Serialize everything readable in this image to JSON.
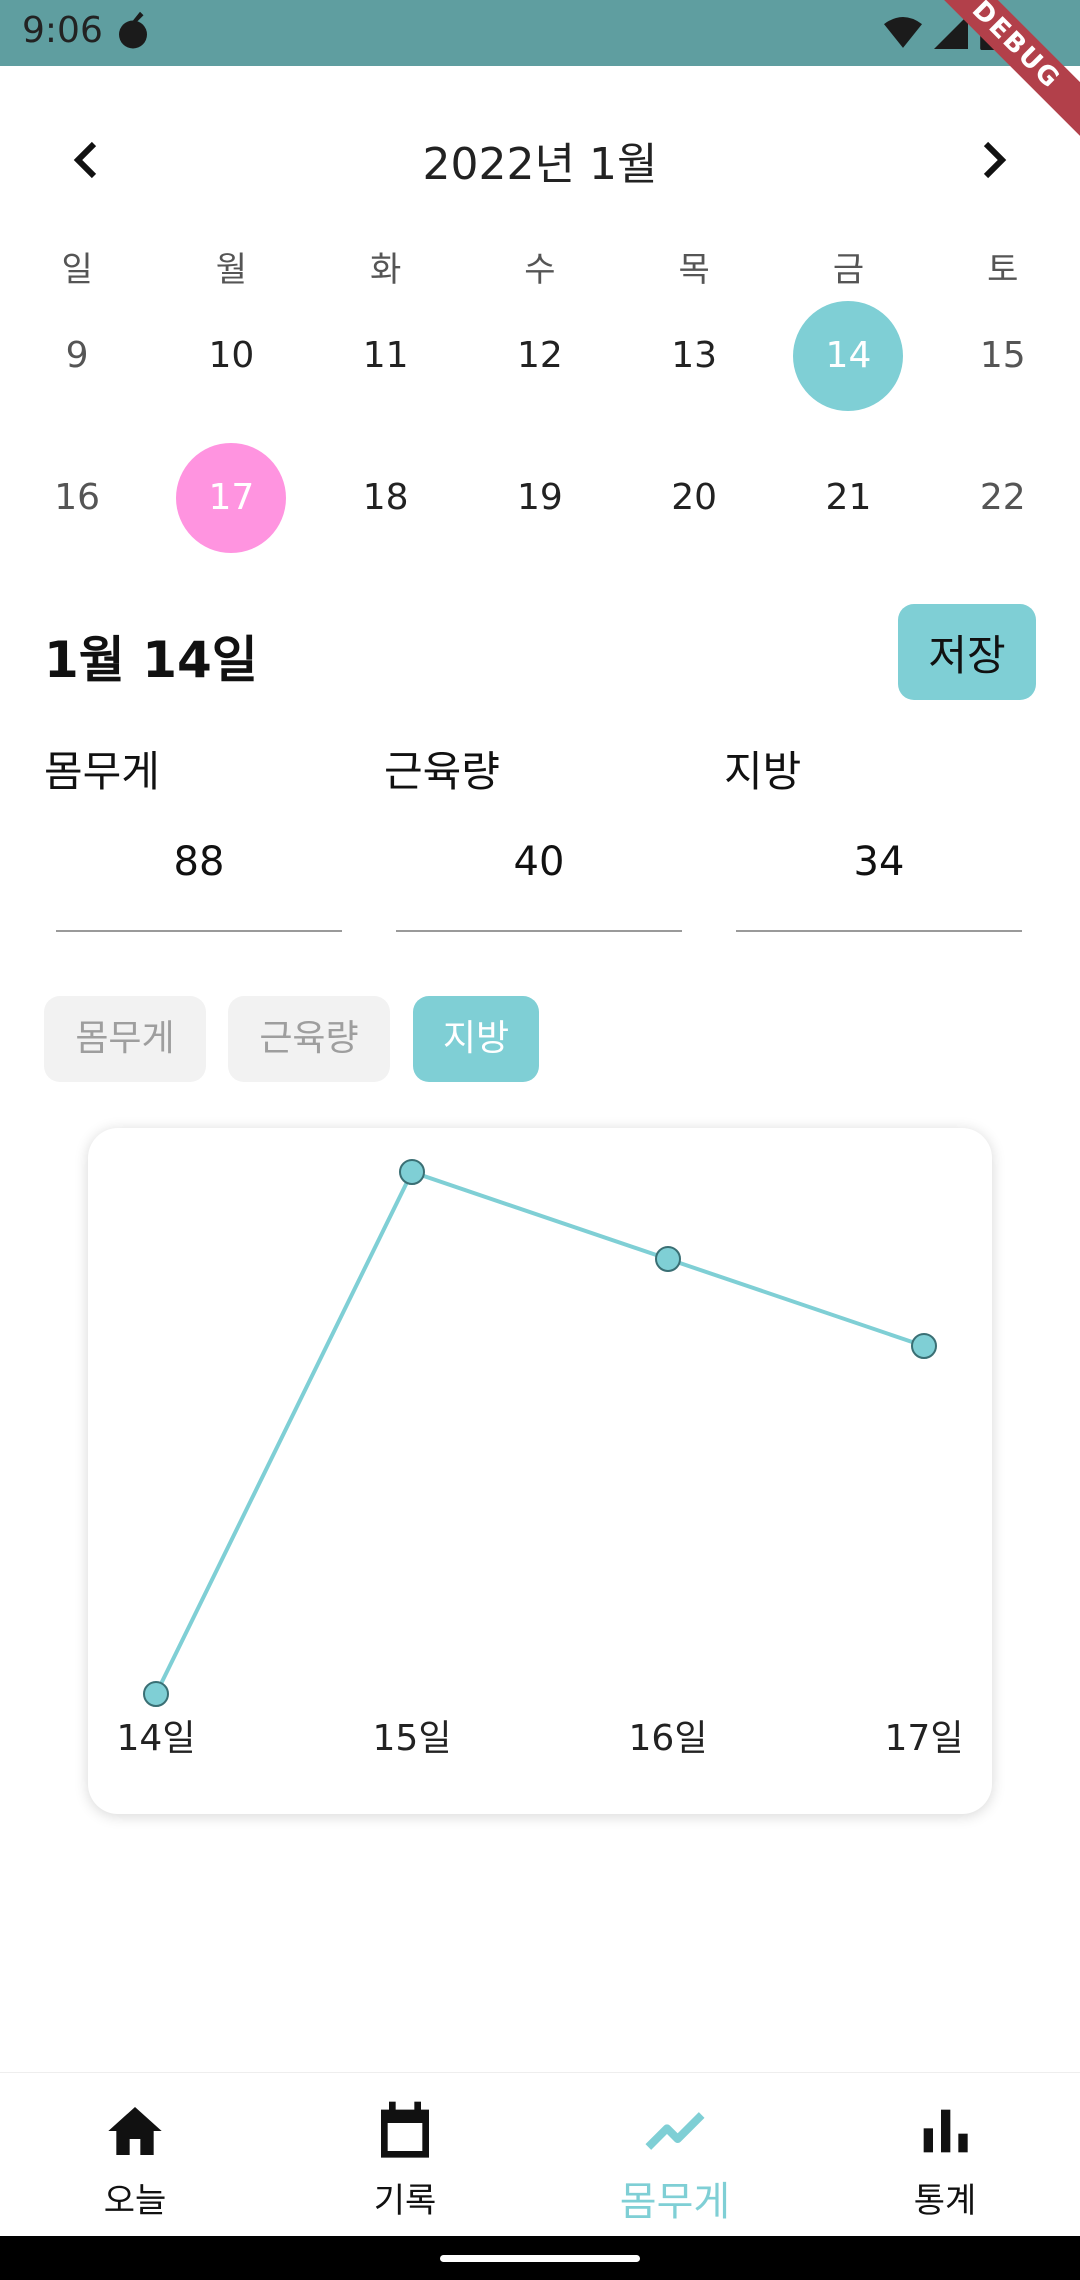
{
  "status_bar": {
    "time": "9:06",
    "debug_label": "DEBUG",
    "background": "#5f9ea0",
    "icons": [
      "notification-icon",
      "wifi-icon",
      "cellular-signal-icon",
      "battery-icon"
    ]
  },
  "calendar": {
    "title": "2022년 1월",
    "weekdays": [
      "일",
      "월",
      "화",
      "수",
      "목",
      "금",
      "토"
    ],
    "weeks": [
      [
        "9",
        "10",
        "11",
        "12",
        "13",
        "14",
        "15"
      ],
      [
        "16",
        "17",
        "18",
        "19",
        "20",
        "21",
        "22"
      ]
    ],
    "selected_date": "14",
    "today_date": "17",
    "selected_color": "#7fcfd5",
    "today_color": "#ff94e0"
  },
  "detail": {
    "date_label": "1월 14일",
    "save_label": "저장"
  },
  "metrics": [
    {
      "label": "몸무게",
      "value": "88"
    },
    {
      "label": "근육량",
      "value": "40"
    },
    {
      "label": "지방",
      "value": "34"
    }
  ],
  "chips": [
    {
      "label": "몸무게",
      "active": false
    },
    {
      "label": "근육량",
      "active": false
    },
    {
      "label": "지방",
      "active": true
    }
  ],
  "chart_data": {
    "type": "line",
    "categories": [
      "14일",
      "15일",
      "16일",
      "17일"
    ],
    "series": [
      {
        "values": [
          34,
          40,
          39,
          38
        ]
      }
    ],
    "ylim": [
      34,
      40
    ],
    "grid": false,
    "line_color": "#7fcfd5"
  },
  "bottom_nav": {
    "items": [
      {
        "label": "오늘",
        "icon": "home-icon",
        "active": false
      },
      {
        "label": "기록",
        "icon": "calendar-icon",
        "active": false
      },
      {
        "label": "몸무게",
        "icon": "trending-line-icon",
        "active": true
      },
      {
        "label": "통계",
        "icon": "bar-chart-icon",
        "active": false
      }
    ],
    "active_color": "#7fcfd5"
  }
}
